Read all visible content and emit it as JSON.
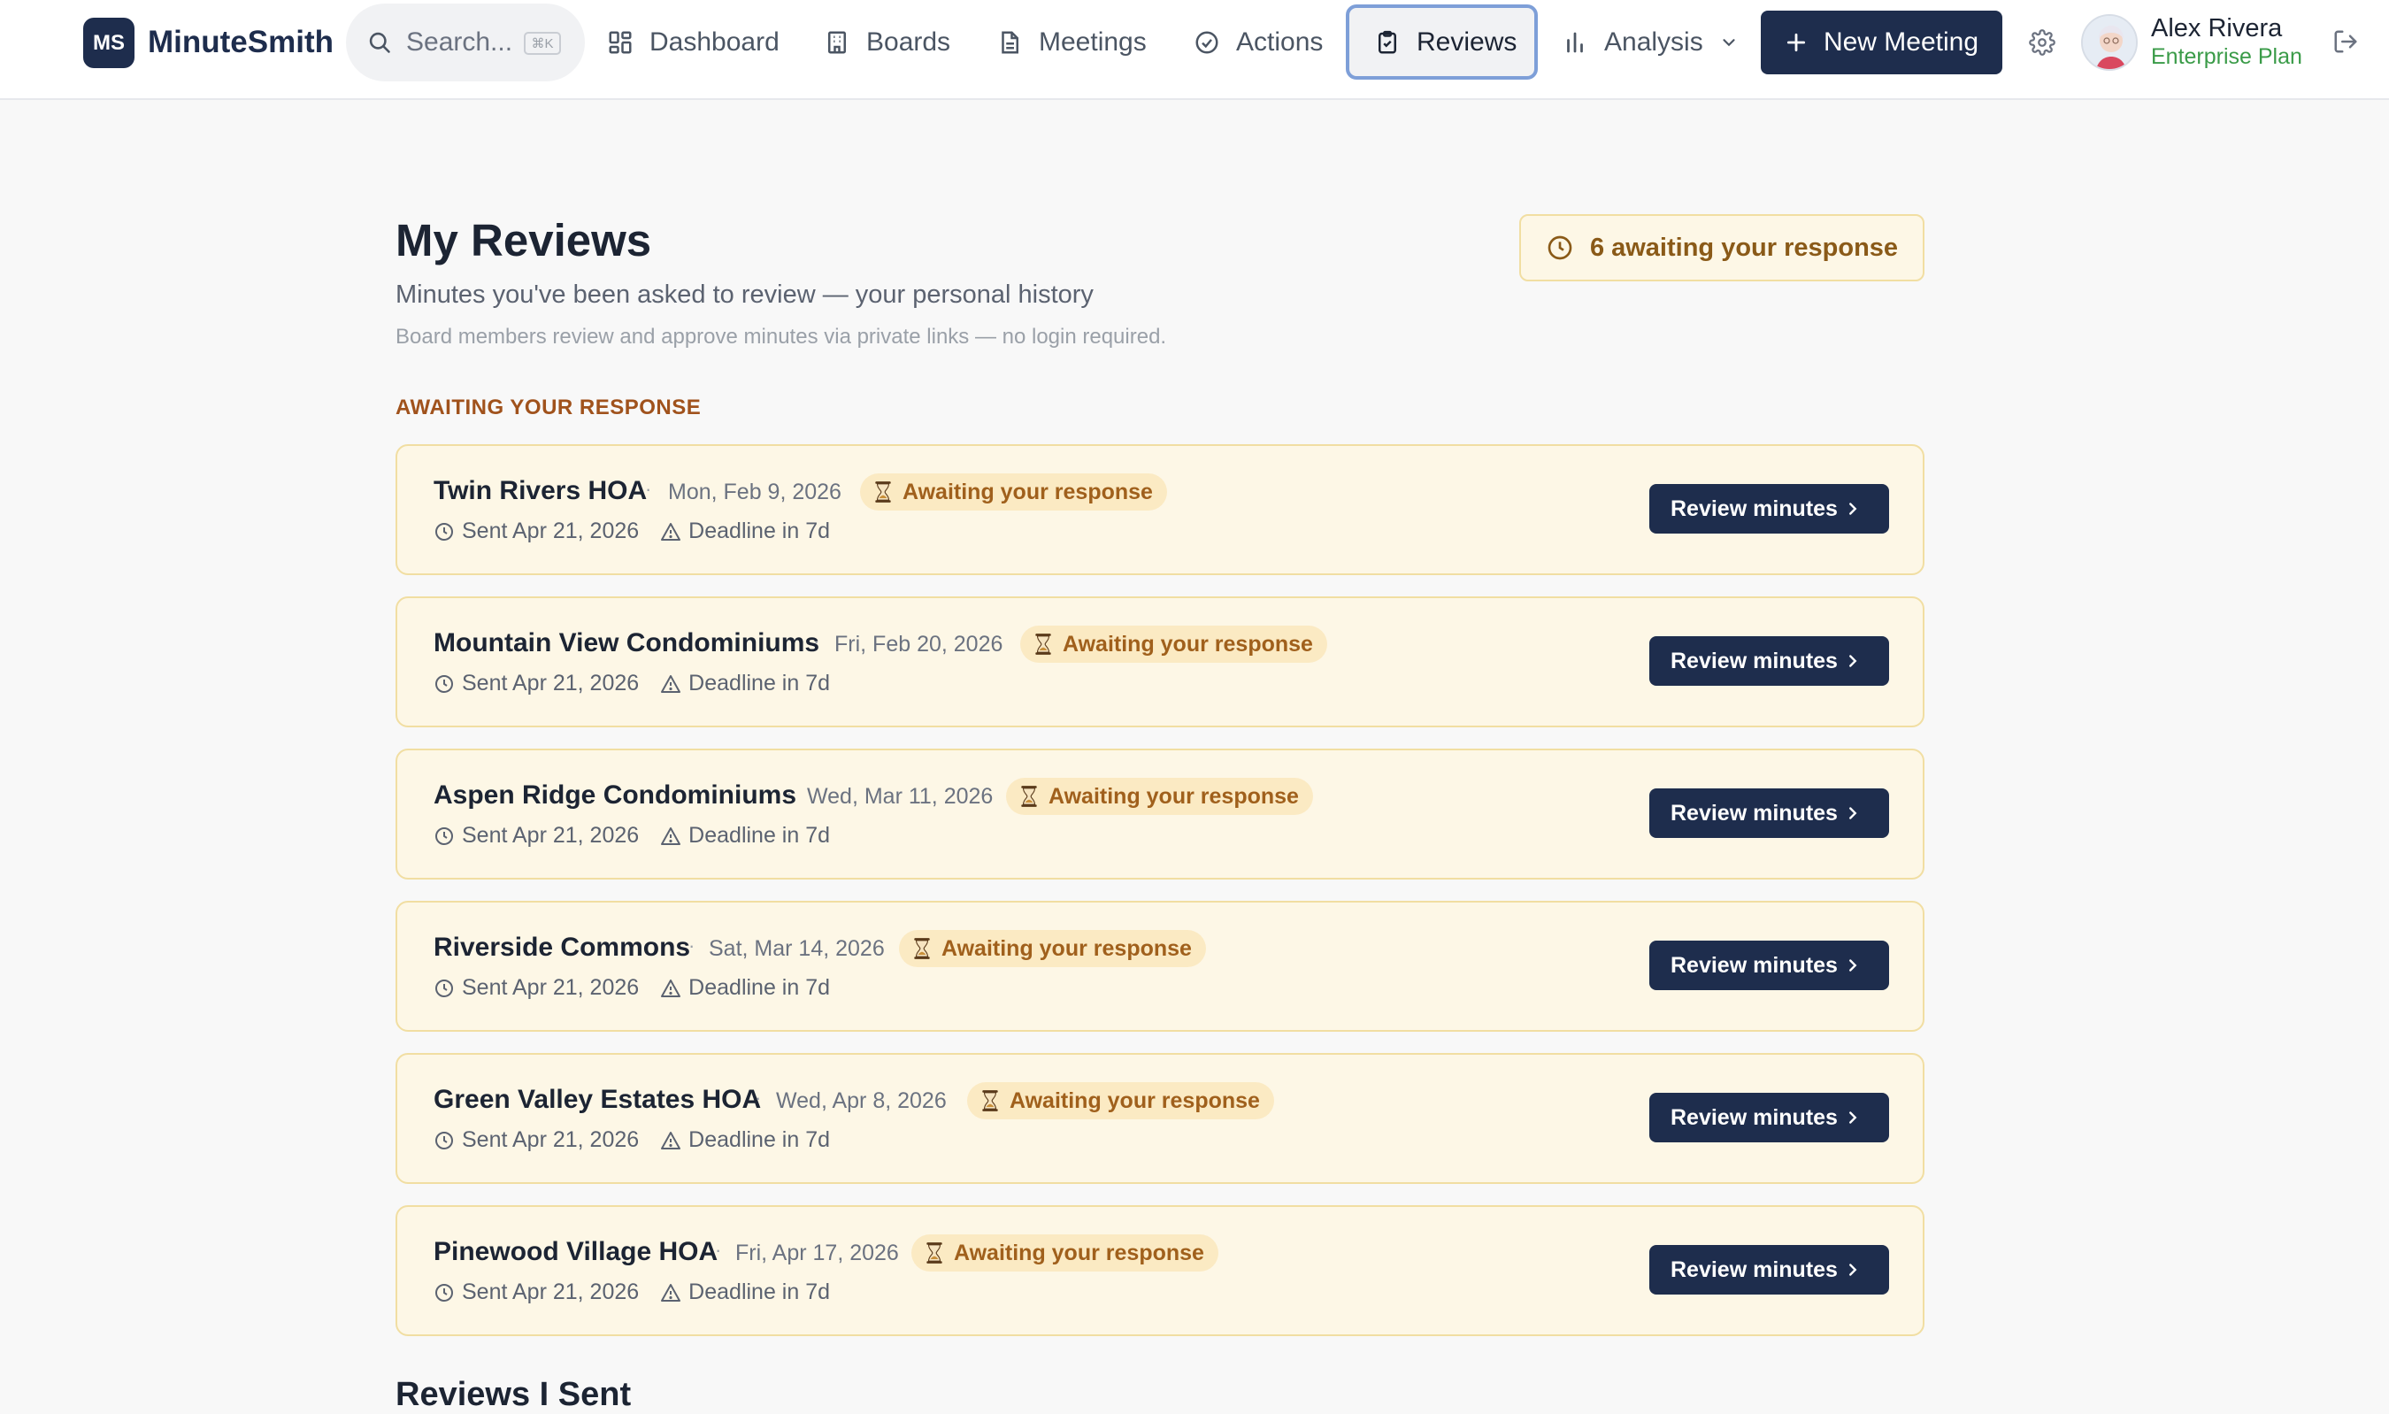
{
  "app": {
    "logo_initials": "MS",
    "name": "MinuteSmith"
  },
  "search": {
    "placeholder": "Search...",
    "shortcut": "⌘K"
  },
  "nav": {
    "dashboard": "Dashboard",
    "boards": "Boards",
    "meetings": "Meetings",
    "actions": "Actions",
    "reviews": "Reviews",
    "analysis": "Analysis"
  },
  "header": {
    "new_meeting_label": "New Meeting"
  },
  "user": {
    "name": "Alex Rivera",
    "plan": "Enterprise Plan"
  },
  "page": {
    "title": "My Reviews",
    "subtitle": "Minutes you've been asked to review — your personal history",
    "note": "Board members review and approve minutes via private links — no login required.",
    "awaiting_summary": "6 awaiting your response",
    "section_awaiting": "AWAITING YOUR RESPONSE",
    "section_sent": "Reviews I Sent"
  },
  "reviews": [
    {
      "org": "Twin Rivers HOA",
      "meeting_date": "Mon, Feb 9, 2026",
      "status": "Awaiting your response",
      "sent": "Sent Apr 21, 2026",
      "deadline": "Deadline in 7d",
      "action": "Review minutes"
    },
    {
      "org": "Mountain View Condominiums",
      "meeting_date": "Fri, Feb 20, 2026",
      "status": "Awaiting your response",
      "sent": "Sent Apr 21, 2026",
      "deadline": "Deadline in 7d",
      "action": "Review minutes"
    },
    {
      "org": "Aspen Ridge Condominiums",
      "meeting_date": "Wed, Mar 11, 2026",
      "status": "Awaiting your response",
      "sent": "Sent Apr 21, 2026",
      "deadline": "Deadline in 7d",
      "action": "Review minutes"
    },
    {
      "org": "Riverside Commons",
      "meeting_date": "Sat, Mar 14, 2026",
      "status": "Awaiting your response",
      "sent": "Sent Apr 21, 2026",
      "deadline": "Deadline in 7d",
      "action": "Review minutes"
    },
    {
      "org": "Green Valley Estates HOA",
      "meeting_date": "Wed, Apr 8, 2026",
      "status": "Awaiting your response",
      "sent": "Sent Apr 21, 2026",
      "deadline": "Deadline in 7d",
      "action": "Review minutes"
    },
    {
      "org": "Pinewood Village HOA",
      "meeting_date": "Fri, Apr 17, 2026",
      "status": "Awaiting your response",
      "sent": "Sent Apr 21, 2026",
      "deadline": "Deadline in 7d",
      "action": "Review minutes"
    }
  ],
  "colors": {
    "brand": "#1e2d4d",
    "pending_bg": "#fdf7e6",
    "pending_text": "#a0601c",
    "plan": "#3a9b48"
  }
}
